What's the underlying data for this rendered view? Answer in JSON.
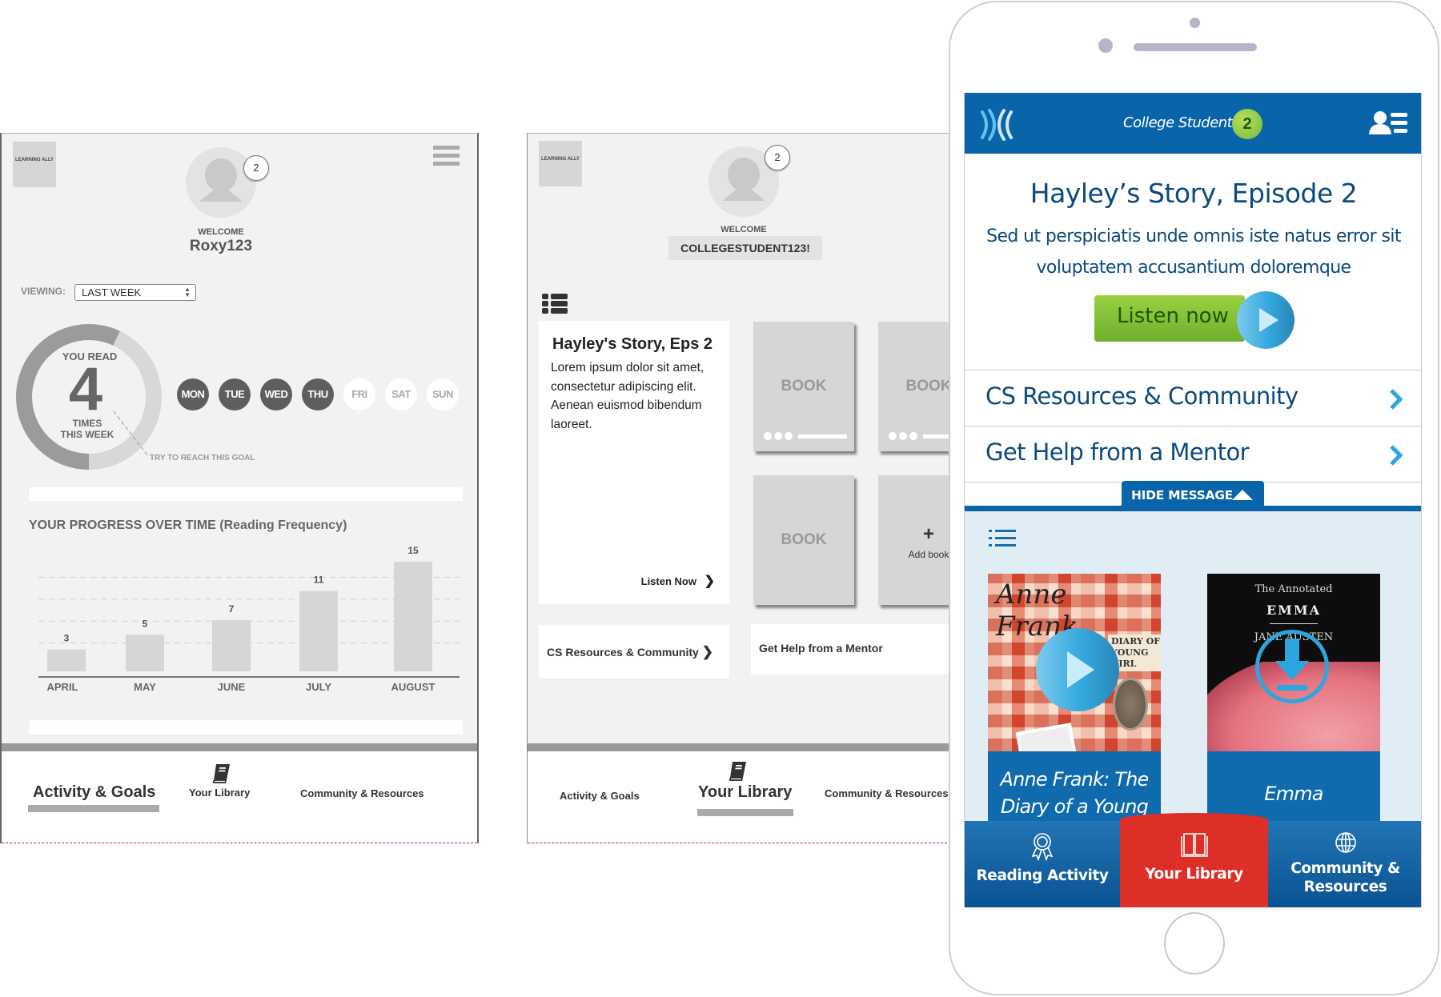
{
  "wireframe_activity": {
    "logo_text": "LEARNING ALLY",
    "notification_count": "2",
    "welcome_label": "WELCOME",
    "username": "Roxy123",
    "viewing_label": "VIEWING:",
    "viewing_value": "LAST WEEK",
    "ring": {
      "top_label": "YOU READ",
      "count": "4",
      "bottom_label_1": "TIMES",
      "bottom_label_2": "THIS WEEK",
      "goal_label": "TRY TO REACH THIS GOAL",
      "progress_fraction": 0.57,
      "goal_fraction": 0.5
    },
    "days": [
      {
        "label": "MON",
        "done": true
      },
      {
        "label": "TUE",
        "done": true
      },
      {
        "label": "WED",
        "done": true
      },
      {
        "label": "THU",
        "done": true
      },
      {
        "label": "FRI",
        "done": false
      },
      {
        "label": "SAT",
        "done": false
      },
      {
        "label": "SUN",
        "done": false
      }
    ],
    "chart_title": "YOUR PROGRESS OVER TIME (Reading Frequency)",
    "nav": {
      "activity": "Activity & Goals",
      "library": "Your Library",
      "community": "Community & Resources"
    }
  },
  "chart_data": {
    "type": "bar",
    "title": "YOUR PROGRESS OVER TIME (Reading Frequency)",
    "categories": [
      "APRIL",
      "MAY",
      "JUNE",
      "JULY",
      "AUGUST"
    ],
    "values": [
      3,
      5,
      7,
      11,
      15
    ],
    "xlabel": "",
    "ylabel": "",
    "ylim": [
      0,
      15
    ],
    "grid": true,
    "data_labels": true
  },
  "wireframe_library": {
    "logo_text": "LEARNING ALLY",
    "notification_count": "2",
    "welcome_label": "WELCOME",
    "username": "COLLEGESTUDENT123!",
    "story": {
      "title": "Hayley's Story, Eps 2",
      "body": "Lorem ipsum dolor sit amet, consectetur adipiscing elit. Aenean euismod bibendum laoreet.",
      "cta": "Listen Now"
    },
    "books": [
      {
        "label": "BOOK",
        "has_progress": true
      },
      {
        "label": "BOOK",
        "has_progress": true
      },
      {
        "label": "BOOK",
        "has_progress": false
      }
    ],
    "add_book": {
      "plus": "+",
      "label": "Add book"
    },
    "links": {
      "resources": "CS Resources & Community",
      "mentor": "Get Help from a Mentor"
    },
    "nav": {
      "activity": "Activity & Goals",
      "library": "Your Library",
      "community": "Community & Resources"
    }
  },
  "phone": {
    "header": {
      "title": "College Student",
      "count": "2",
      "brand_color": "#0a64aa"
    },
    "message": {
      "title": "Hayley’s Story, Episode 2",
      "body": "Sed ut perspiciatis unde omnis iste natus error sit voluptatem accusantium doloremque",
      "cta": "Listen now"
    },
    "rows": [
      {
        "label": "CS Resources & Community"
      },
      {
        "label": "Get Help from a Mentor"
      }
    ],
    "hide_message": "HIDE MESSAGE",
    "books": [
      {
        "title": "Anne Frank: The Diary of a Young Girl",
        "cover_text_1": "Anne Frank.",
        "cover_text_2": "DIARY OF",
        "cover_text_3": "YOUNG GIRL",
        "action": "play"
      },
      {
        "title": "Emma",
        "cover_text_1": "The Annotated",
        "cover_text_2": "EMMA",
        "cover_text_3": "JANE AUSTEN",
        "action": "download"
      }
    ],
    "nav": [
      {
        "label": "Reading Activity",
        "icon": "award-ribbon-icon",
        "active": false
      },
      {
        "label": "Your Library",
        "icon": "open-book-icon",
        "active": true
      },
      {
        "label": "Community & Resources",
        "icon": "globe-icon",
        "active": false
      }
    ],
    "active_color": "#dd2e28"
  }
}
